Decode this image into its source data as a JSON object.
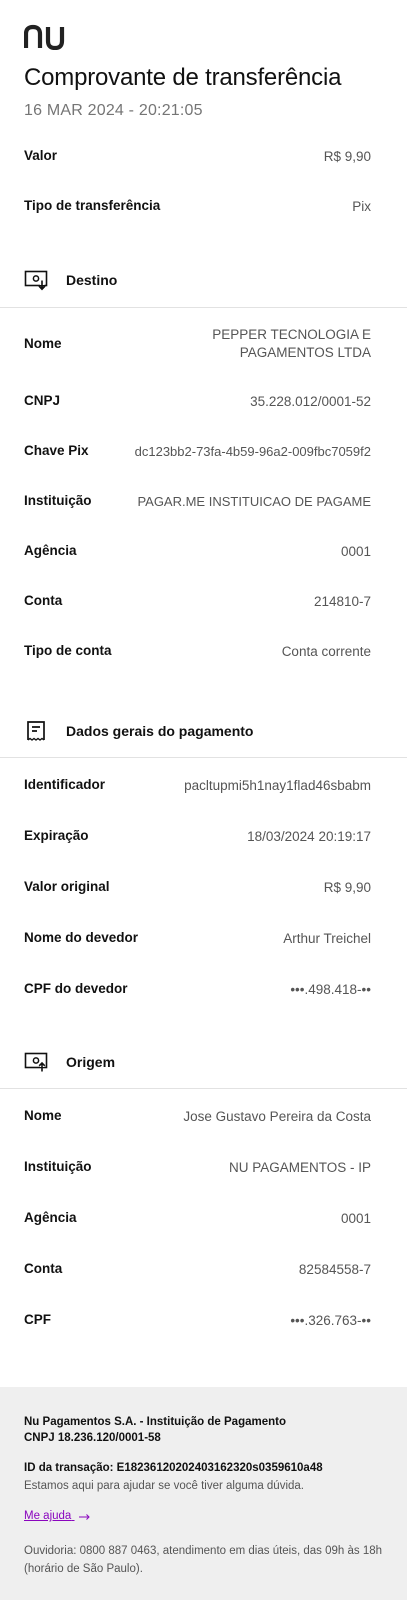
{
  "brand": {
    "logo_text": "nu",
    "icon": "nubank-logo-icon",
    "accent": "#8a05be"
  },
  "header": {
    "title": "Comprovante de transferência",
    "date": "16 MAR 2024 - 20:21:05"
  },
  "summary": [
    {
      "label": "Valor",
      "value": "R$ 9,90"
    },
    {
      "label": "Tipo de transferência",
      "value": "Pix"
    }
  ],
  "destino": {
    "title": "Destino",
    "icon": "money-down-icon",
    "rows": [
      {
        "label": "Nome",
        "value": "PEPPER TECNOLOGIA E PAGAMENTOS LTDA"
      },
      {
        "label": "CNPJ",
        "value": "35.228.012/0001-52"
      },
      {
        "label": "Chave Pix",
        "value": "dc123bb2-73fa-4b59-96a2-009fbc7059f2"
      },
      {
        "label": "Instituição",
        "value": "PAGAR.ME INSTITUICAO DE PAGAME"
      },
      {
        "label": "Agência",
        "value": "0001"
      },
      {
        "label": "Conta",
        "value": "214810-7"
      },
      {
        "label": "Tipo de conta",
        "value": "Conta corrente"
      }
    ]
  },
  "dados": {
    "title": "Dados gerais do pagamento",
    "icon": "receipt-icon",
    "rows": [
      {
        "label": "Identificador",
        "value": "pacltupmi5h1nay1flad46sbabm"
      },
      {
        "label": "Expiração",
        "value": "18/03/2024 20:19:17"
      },
      {
        "label": "Valor original",
        "value": "R$ 9,90"
      },
      {
        "label": "Nome do devedor",
        "value": "Arthur Treichel"
      },
      {
        "label": "CPF do devedor",
        "value": "•••.498.418-••"
      }
    ]
  },
  "origem": {
    "title": "Origem",
    "icon": "money-up-icon",
    "rows": [
      {
        "label": "Nome",
        "value": "Jose Gustavo Pereira da Costa"
      },
      {
        "label": "Instituição",
        "value": "NU PAGAMENTOS - IP"
      },
      {
        "label": "Agência",
        "value": "0001"
      },
      {
        "label": "Conta",
        "value": "82584558-7"
      },
      {
        "label": "CPF",
        "value": "•••.326.763-••"
      }
    ]
  },
  "footer": {
    "company_line1": "Nu Pagamentos S.A. - Instituição de Pagamento",
    "company_line2": "CNPJ 18.236.120/0001-58",
    "transaction_id": "ID da transação: E18236120202403162320s0359610a48",
    "help_text": "Estamos aqui para ajudar se você tiver alguma dúvida.",
    "help_link": "Me ajuda",
    "ouvidoria": "Ouvidoria: 0800 887 0463, atendimento em dias úteis, das 09h às 18h (horário de São Paulo)."
  }
}
